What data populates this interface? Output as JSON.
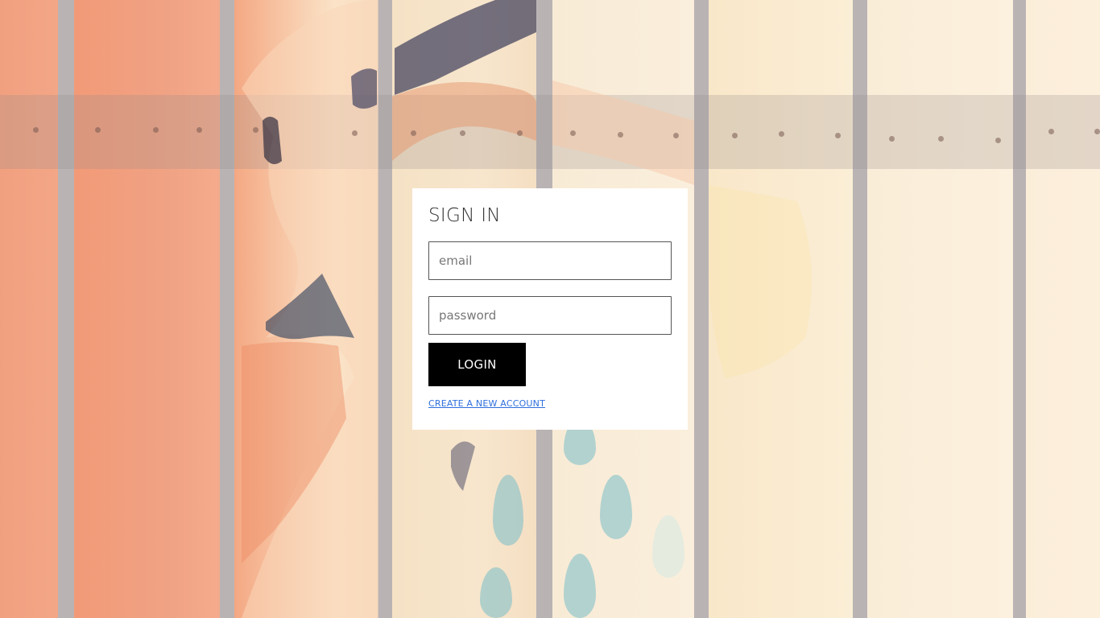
{
  "signin": {
    "title": "SIGN IN",
    "email_placeholder": "email",
    "password_placeholder": "password",
    "login_label": "LOGIN",
    "create_account_label": "CREATE A NEW ACCOUNT"
  }
}
